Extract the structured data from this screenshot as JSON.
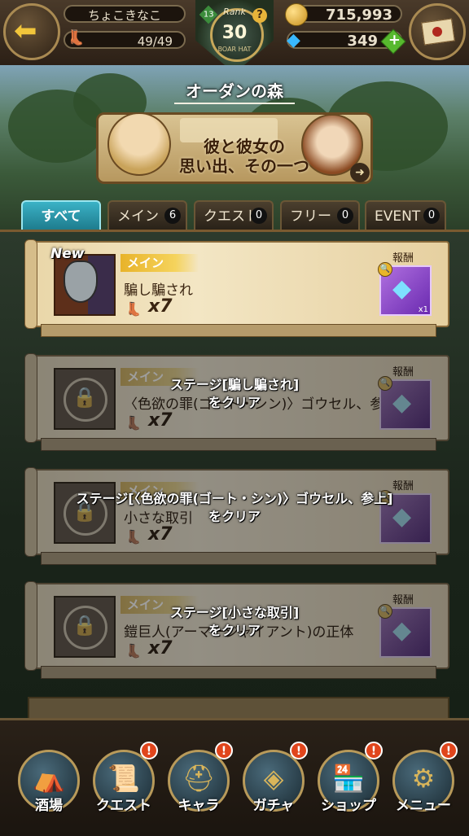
{
  "header": {
    "player_name": "ちょこきなこ",
    "stamina": "49/49",
    "rank_label": "Rank",
    "rank_value": "30",
    "rank_sub": "BOAR HAT",
    "level_badge": "13",
    "help": "?",
    "gold": "715,993",
    "gems": "349",
    "gem_plus": "+"
  },
  "area": {
    "title": "オーダンの森",
    "story_title_line1": "彼と彼女の",
    "story_title_line2": "思い出、その一つ"
  },
  "tabs": [
    {
      "label": "すべて",
      "count": ""
    },
    {
      "label": "メイン",
      "count": "6"
    },
    {
      "label": "クエスト",
      "count": "0"
    },
    {
      "label": "フリー",
      "count": "0"
    },
    {
      "label": "EVENT",
      "count": "0"
    }
  ],
  "quests": [
    {
      "new": "New",
      "type": "メイン",
      "name": "騙し騙され",
      "cost": "x7",
      "reward_label": "報酬",
      "reward_icon": "gem-icon"
    },
    {
      "type": "メイン",
      "name": "〈色欲の罪(ゴート・シン)〉ゴウセル、参上",
      "cost": "x7",
      "reward_label": "報酬",
      "lock_line1": "ステージ[騙し騙され]",
      "lock_line2": "をクリア"
    },
    {
      "type": "メイン",
      "name": "小さな取引",
      "cost": "x7",
      "reward_label": "報酬",
      "lock_line1": "ステージ[〈色欲の罪(ゴート・シン)〉ゴウセル、参上]",
      "lock_line2": "をクリア"
    },
    {
      "type": "メイン",
      "name": "鎧巨人(アーマージャイアント)の正体",
      "cost": "x7",
      "reward_label": "報酬",
      "lock_line1": "ステージ[小さな取引]",
      "lock_line2": "をクリア"
    }
  ],
  "nav": [
    {
      "label": "酒場",
      "icon": "tavern-icon",
      "alert": ""
    },
    {
      "label": "クエスト",
      "icon": "scroll-icon",
      "alert": "!"
    },
    {
      "label": "キャラ",
      "icon": "helmet-icon",
      "alert": "!"
    },
    {
      "label": "ガチャ",
      "icon": "crystal-icon",
      "alert": "!"
    },
    {
      "label": "ショップ",
      "icon": "shop-icon",
      "alert": "!"
    },
    {
      "label": "メニュー",
      "icon": "gear-icon",
      "alert": "!"
    }
  ],
  "colors": {
    "accent_tab": "#2aa0b6",
    "type_tag": "#e8b32a",
    "alert": "#e0451c"
  }
}
